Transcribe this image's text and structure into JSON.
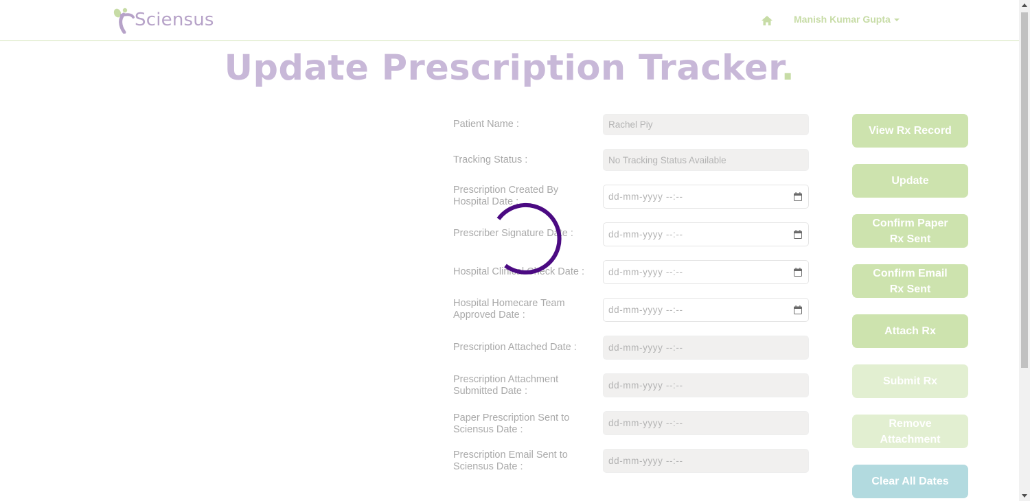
{
  "header": {
    "logo_text": "Sciensus",
    "user_name": "Manish Kumar Gupta",
    "home_icon": "home-icon"
  },
  "page": {
    "title": "Update Prescription Tracker",
    "title_dot": "."
  },
  "form": {
    "patient_name": {
      "label": "Patient Name :",
      "value": "Rachel Piy"
    },
    "tracking_status": {
      "label": "Tracking Status :",
      "value": "No Tracking Status Available"
    },
    "created_by_hospital": {
      "label_line1": "Prescription Created By",
      "label_line2": "Hospital Date :",
      "value": "dd-mm-yyyy --:--"
    },
    "prescriber_signature": {
      "label": "Prescriber Signature Date :",
      "value": "dd-mm-yyyy --:--"
    },
    "hospital_clinical_check": {
      "label": "Hospital Clinical Check Date :",
      "value": "dd-mm-yyyy --:--"
    },
    "homecare_team_approved": {
      "label_line1": "Hospital Homecare Team",
      "label_line2": "Approved Date :",
      "value": "dd-mm-yyyy --:--"
    },
    "prescription_attached": {
      "label": "Prescription Attached Date :",
      "value": "dd-mm-yyyy --:--"
    },
    "attachment_submitted": {
      "label_line1": "Prescription Attachment",
      "label_line2": "Submitted Date :",
      "value": "dd-mm-yyyy --:--"
    },
    "paper_sent": {
      "label_line1": "Paper Prescription Sent to",
      "label_line2": "Sciensus Date :",
      "value": "dd-mm-yyyy --:--"
    },
    "email_sent": {
      "label_line1": "Prescription Email Sent to",
      "label_line2": "Sciensus Date :",
      "value": "dd-mm-yyyy --:--"
    }
  },
  "actions": {
    "view_rx_record": "View Rx Record",
    "update": "Update",
    "confirm_paper_line1": "Confirm Paper",
    "confirm_paper_line2": "Rx Sent",
    "confirm_email_line1": "Confirm Email",
    "confirm_email_line2": "Rx Sent",
    "attach_rx": "Attach Rx",
    "submit_rx": "Submit Rx",
    "remove_attachment_line1": "Remove",
    "remove_attachment_line2": "Attachment",
    "clear_all_dates": "Clear All Dates"
  },
  "colors": {
    "brand_green": "#cde3ae",
    "brand_green_disabled": "#e2efd1",
    "brand_purple": "#b6a2c8",
    "accent_blue": "#b2dadf",
    "spinner": "#4b0a82"
  }
}
